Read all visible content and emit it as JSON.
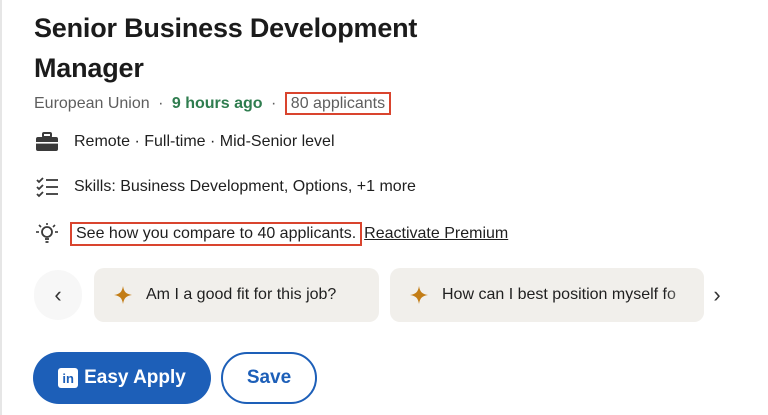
{
  "job": {
    "title": "Senior Business Development Manager",
    "location": "European Union",
    "separator": "·",
    "posted": "9 hours ago",
    "applicants": "80 applicants"
  },
  "insights": {
    "work_type": "Remote · Full-time · Mid-Senior level",
    "skills": "Skills: Business Development, Options, +1 more",
    "compare": "See how you compare to 40 applicants.",
    "premium_link": "Reactivate Premium"
  },
  "carousel": {
    "prev_glyph": "‹",
    "next_glyph": "›",
    "chips": [
      {
        "label": "Am I a good fit for this job?"
      },
      {
        "label": "How can I best position myself fo"
      }
    ]
  },
  "actions": {
    "easy_apply_logo": "in",
    "easy_apply_label": "Easy Apply",
    "save_label": "Save"
  },
  "colors": {
    "posted_green": "#2f7d4f",
    "highlight_red": "#d9442e",
    "primary_blue": "#1d5fb8",
    "chip_bg": "#f1efeb",
    "spark_orange": "#c37d16"
  }
}
